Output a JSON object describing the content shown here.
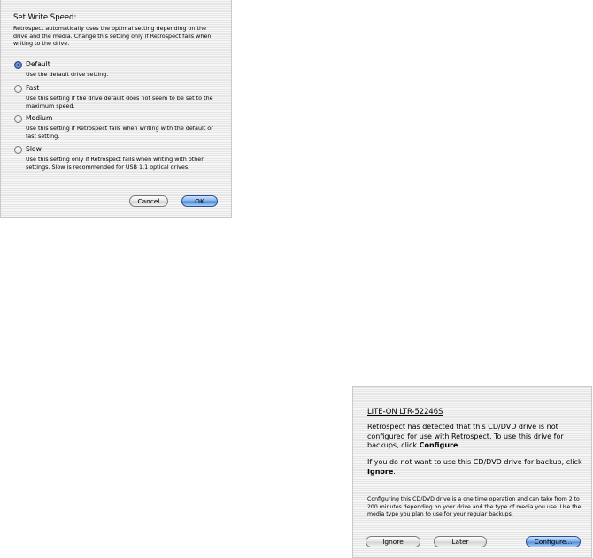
{
  "speed_dialog": {
    "title": "Set Write Speed:",
    "description": "Retrospect automatically uses the optimal setting depending on the drive and the media. Change this setting only if Retrospect fails when writing to the drive.",
    "options": [
      {
        "label": "Default",
        "description": "Use the default drive setting.",
        "selected": true
      },
      {
        "label": "Fast",
        "description": "Use this setting if the drive default does not seem to be set to the maximum speed.",
        "selected": false
      },
      {
        "label": "Medium",
        "description": "Use this setting if Retrospect fails when writing with the default or fast setting.",
        "selected": false
      },
      {
        "label": "Slow",
        "description": "Use this setting only if Retrospect fails when writing with other settings. Slow is recommended for USB 1.1 optical drives.",
        "selected": false
      }
    ],
    "cancel_label": "Cancel",
    "ok_label": "OK"
  },
  "drive_dialog": {
    "drive_name": "LITE-ON LTR-52246S",
    "para1_prefix": "Retrospect has detected that this CD/DVD drive is not configured for use with Retrospect. To use this drive for backups, click ",
    "para1_bold": "Configure",
    "para1_suffix": ".",
    "para2_prefix": "If you do not want to use this CD/DVD drive for backup, click ",
    "para2_bold": "Ignore",
    "para2_suffix": ".",
    "note": "Configuring this CD/DVD drive is a one time operation and can take from 2 to 200 minutes depending on your drive and the type of media you use. Use the media type you plan to use for your regular backups.",
    "ignore_label": "Ignore",
    "later_label": "Later",
    "configure_label": "Configure..."
  },
  "colors": {
    "sheet_background": "#ececec",
    "default_button": "#4c88d8"
  }
}
